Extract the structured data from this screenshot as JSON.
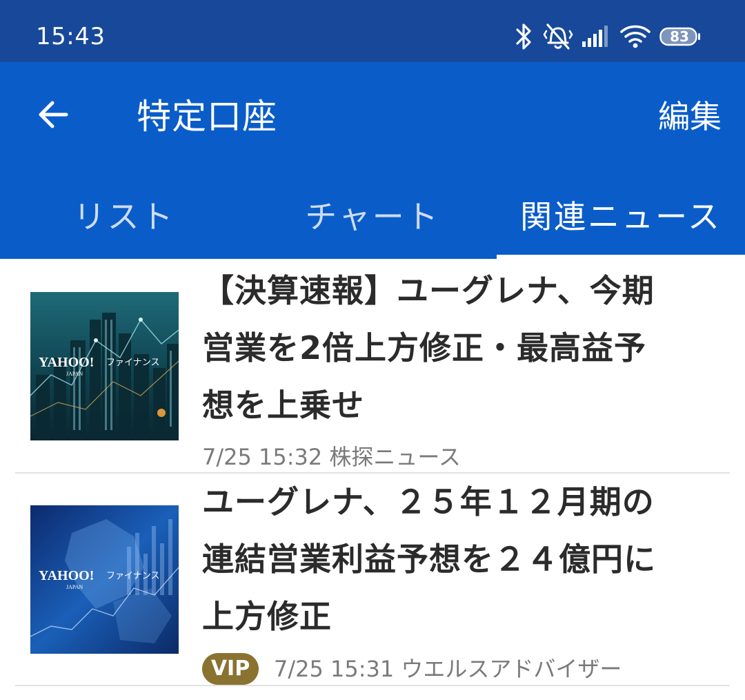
{
  "status_bar": {
    "time": "15:43",
    "battery_level": "83",
    "icons": [
      "bluetooth-icon",
      "vibrate-off-icon",
      "signal-icon",
      "wifi-icon",
      "battery-icon"
    ]
  },
  "app_bar": {
    "title": "特定口座",
    "back_icon": "arrow-left-icon",
    "edit_label": "編集"
  },
  "tabs": [
    {
      "label": "リスト",
      "selected": false
    },
    {
      "label": "チャート",
      "selected": false
    },
    {
      "label": "関連ニュース",
      "selected": true
    }
  ],
  "news": [
    {
      "title_lines": [
        "【決算速報】ユーグレナ、今期",
        "営業を2倍上方修正・最高益予",
        "想を上乗せ"
      ],
      "date": "7/25 15:32",
      "source": "株探ニュース",
      "badge": "",
      "thumbnail": {
        "logo": "YAHOO!",
        "logo_sub": "JAPAN",
        "service": "ファイナンス"
      }
    },
    {
      "title_lines": [
        "ユーグレナ、２５年１２月期の",
        "連結営業利益予想を２４億円に",
        "上方修正"
      ],
      "date": "7/25 15:31",
      "source": "ウエルスアドバイザー",
      "badge": "VIP",
      "thumbnail": {
        "logo": "YAHOO!",
        "logo_sub": "JAPAN",
        "service": "ファイナンス"
      }
    }
  ],
  "colors": {
    "status_bar": "#17489a",
    "app_bar": "#0a5dc9",
    "title_text": "#2b2b2b",
    "meta_text": "#7a7a7a",
    "vip_badge": "#8a7230",
    "divider": "#e2e2e2"
  }
}
